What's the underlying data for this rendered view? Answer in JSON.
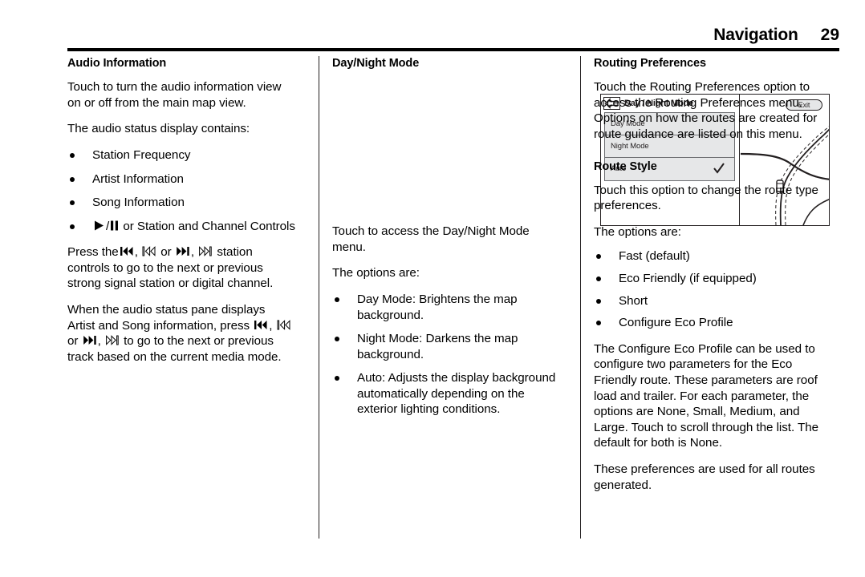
{
  "header": {
    "title": "Navigation",
    "page_number": "29"
  },
  "columns": {
    "col1": {
      "heading": "Audio Information",
      "p1": "Touch to turn the audio information view on or off from the main map view.",
      "p2": "The audio status display contains:",
      "bullets": [
        {
          "text": "Station Frequency"
        },
        {
          "text": "Artist Information"
        },
        {
          "text": "Song Information"
        },
        {
          "text": "or Station and Channel Controls",
          "icons": [
            "play-icon",
            "pause-icon"
          ]
        }
      ],
      "p3_a": "Press the",
      "p3_b": ",",
      "p3_c": "or",
      "p3_d": ",",
      "p3_e": "station controls to go to the next or previous strong signal station or digital channel.",
      "p4_a": "When the audio status pane displays Artist and Song information, press",
      "p4_b": ",",
      "p4_c": "or",
      "p4_d": ",",
      "p4_e": "to go to the next or previous track based on the current media mode."
    },
    "col2": {
      "heading": "Day/Night Mode",
      "screenshot": {
        "back_icon": "back-arrow-icon",
        "title": "Day / Night Mode",
        "menu_items": [
          {
            "label": "Day Mode",
            "checked": false
          },
          {
            "label": "Night Mode",
            "checked": false
          },
          {
            "label": "Auto",
            "checked": true
          }
        ],
        "exit_label": "Exit"
      },
      "p1": "Touch to access the Day/Night Mode menu.",
      "p2": "The options are:",
      "bullets": [
        "Day Mode: Brightens the map background.",
        "Night Mode: Darkens the map background.",
        "Auto: Adjusts the display background automatically depending on the exterior lighting conditions."
      ]
    },
    "col3": {
      "heading1": "Routing Preferences",
      "p1": "Touch the Routing Preferences option to access the Routing Preferences menu. Options on how the routes are created for route guidance are listed on this menu.",
      "heading2": "Route Style",
      "p2": "Touch this option to change the route type preferences.",
      "p3": "The options are:",
      "bullets": [
        "Fast (default)",
        "Eco Friendly (if equipped)",
        "Short",
        "Configure Eco Profile"
      ],
      "p4": "The Configure Eco Profile can be used to configure two parameters for the Eco Friendly route. These parameters are roof load and trailer. For each parameter, the options are None, Small, Medium, and Large. Touch to scroll through the list. The default for both is None.",
      "p5": "These preferences are used for all routes generated."
    }
  },
  "colors": {
    "text": "#000000",
    "rule": "#000000",
    "ui_gray": "#e6e7e8",
    "ui_border": "#6d6e71"
  }
}
